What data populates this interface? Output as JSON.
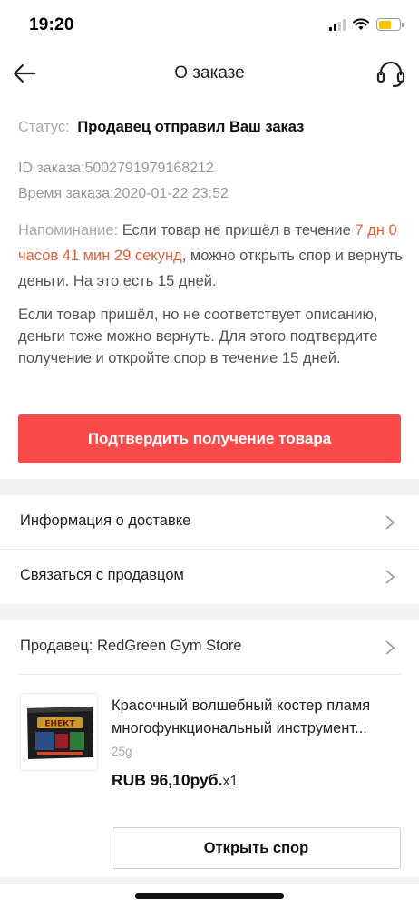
{
  "status_bar": {
    "time": "19:20"
  },
  "nav": {
    "title": "О заказе"
  },
  "order": {
    "status_label": "Статус:",
    "status_value": "Продавец отправил Ваш заказ",
    "id_label": "ID заказа:",
    "id_value": "5002791979168212",
    "time_label": "Время заказа:",
    "time_value": "2020-01-22 23:52",
    "reminder_label": "Напоминание:",
    "reminder_before": " Если товар не пришёл в течение ",
    "reminder_countdown": "7 дн 0 часов 41 мин 29 секунд",
    "reminder_after": ", можно открыть спор и вернуть деньги. На это есть 15 дней.",
    "note": "Если товар пришёл, но не соответствует описанию, деньги тоже можно вернуть. Для этого подтвердите получение и откройте спор в течение 15 дней.",
    "confirm_button": "Подтвердить получение товара"
  },
  "menu": {
    "delivery_info": "Информация о доставке",
    "contact_seller": "Связаться с продавцом"
  },
  "seller": {
    "label": "Продавец: RedGreen Gym Store"
  },
  "product": {
    "title": "Красочный волшебный костер пламя многофункциональный инструмент...",
    "weight": "25g",
    "price": "RUB 96,10руб.",
    "quantity": "x1",
    "image_text": "ЕНЕКТ"
  },
  "actions": {
    "open_dispute": "Открыть спор"
  },
  "colors": {
    "accent": "#fa4a4a",
    "highlight": "#e5603a",
    "battery": "#f4c400"
  }
}
